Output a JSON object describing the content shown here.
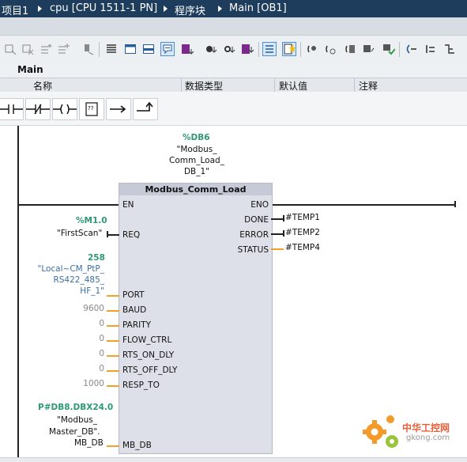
{
  "breadcrumb": {
    "items": [
      "项目1",
      "cpu [CPU 1511-1 PN]",
      "程序块",
      "Main [OB1]"
    ]
  },
  "block_header": {
    "title": "Main"
  },
  "interface_columns": [
    "名称",
    "数据类型",
    "默认值",
    "注释"
  ],
  "ladder_toolbar": {
    "items": [
      "normally-open-contact",
      "normally-closed-contact",
      "coil",
      "empty-box",
      "open-branch",
      "close-branch"
    ],
    "empty_box_text": "??"
  },
  "instance": {
    "address": "%DB6",
    "lines": [
      "\"Modbus_",
      "Comm_Load_",
      "DB_1\""
    ]
  },
  "block": {
    "title": "Modbus_Comm_Load",
    "left_pins": [
      "EN",
      "REQ",
      "PORT",
      "BAUD",
      "PARITY",
      "FLOW_CTRL",
      "RTS_ON_DLY",
      "RTS_OFF_DLY",
      "RESP_TO",
      "MB_DB"
    ],
    "right_pins": [
      "ENO",
      "DONE",
      "ERROR",
      "STATUS"
    ]
  },
  "inputs": {
    "req_address": "%M1.0",
    "req_symbol": "\"FirstScan\"",
    "port_value": "258",
    "port_lines": [
      "\"Local~CM_PtP_",
      "RS422_485_",
      "HF_1\""
    ],
    "baud": "9600",
    "parity": "0",
    "flow_ctrl": "0",
    "rts_on_dly": "0",
    "rts_off_dly": "0",
    "resp_to": "1000",
    "mb_db_address": "P#DB8.DBX24.0",
    "mb_db_lines": [
      "\"Modbus_",
      "Master_DB\".",
      "MB_DB"
    ]
  },
  "outputs": {
    "done": "#TEMP1",
    "error": "#TEMP2",
    "status": "#TEMP4"
  },
  "watermark": {
    "text": "中华工控网",
    "url": "gkong.com"
  },
  "colors": {
    "breadcrumb_bg": "#1e3c5b",
    "address_green": "#2e9a74",
    "connector_orange": "#f0a12a",
    "block_fill": "#dde0e8",
    "constant_blue": "#3b6fa6"
  }
}
